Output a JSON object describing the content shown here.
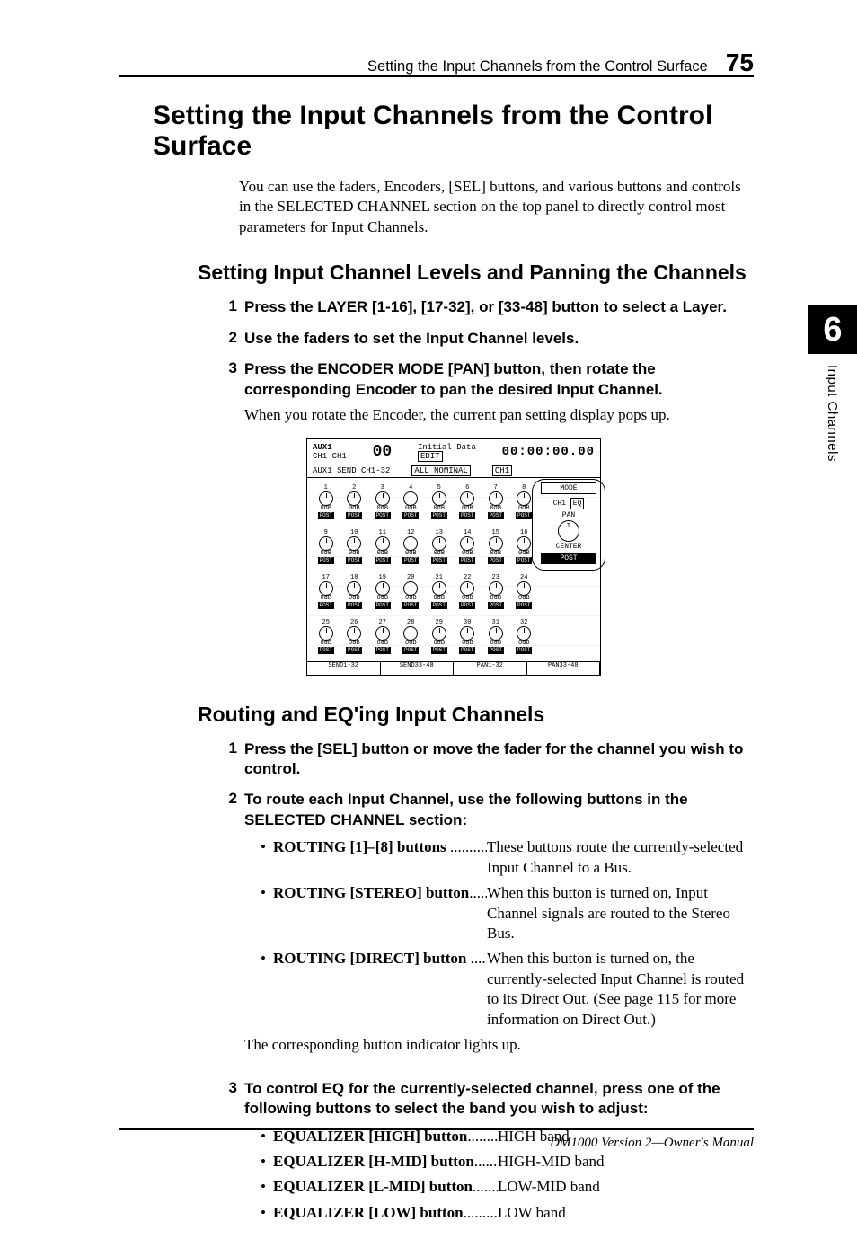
{
  "header": {
    "running_title": "Setting the Input Channels from the Control Surface",
    "page_num": "75"
  },
  "side_tab": {
    "chapter_num": "6",
    "chapter_label": "Input Channels"
  },
  "h1": "Setting the Input Channels from the Control Surface",
  "intro": "You can use the faders, Encoders, [SEL] buttons, and various buttons and controls in the SELECTED CHANNEL section on the top panel to directly control most parameters for Input Channels.",
  "sub1": {
    "title": "Setting Input Channel Levels and Panning the Channels",
    "steps": [
      {
        "n": "1",
        "head": "Press the LAYER [1-16], [17-32], or [33-48] button to select a Layer."
      },
      {
        "n": "2",
        "head": "Use the faders to set the Input Channel levels."
      },
      {
        "n": "3",
        "head": "Press the ENCODER MODE [PAN] button, then rotate the corresponding Encoder to pan the desired Input Channel.",
        "note": "When you rotate the Encoder, the current pan setting display pops up."
      }
    ]
  },
  "screenshot": {
    "title_left": "AUX1",
    "title_ch": "CH1-CH1",
    "scene": "00",
    "scene_label": "Initial Data",
    "edit": "EDIT",
    "time": "00:00:00.00",
    "sub_left": "AUX1  SEND  CH1-32",
    "sub_mid": "ALL NOMINAL",
    "sub_right": "CH1",
    "knob_db": "0dB",
    "knob_post": "POST",
    "right_mode": "MODE",
    "right_ch": "CH1",
    "right_eq": "EQ",
    "right_pan": "PAN",
    "right_center": "CENTER",
    "right_post": "POST",
    "tabs": [
      "SEND1-32",
      "SEND33-48",
      "PAN1-32",
      "PAN33-48"
    ]
  },
  "sub2": {
    "title": "Routing and EQ'ing Input Channels",
    "steps": [
      {
        "n": "1",
        "head": "Press the [SEL] button or move the fader for the channel you wish to control."
      },
      {
        "n": "2",
        "head": "To route each Input Channel, use the following buttons in the SELECTED CHANNEL section:",
        "routing": [
          {
            "label": "ROUTING [1]–[8] buttons",
            "dots": " ...............",
            "desc": "These buttons route the currently-selected Input Channel to a Bus."
          },
          {
            "label": "ROUTING [STEREO] button",
            "dots": "...........",
            "desc": "When this button is turned on, Input Channel signals are routed to the Stereo Bus."
          },
          {
            "label": "ROUTING [DIRECT] button",
            "dots": " ...........",
            "desc": "When this button is turned on, the currently-selected Input Channel is routed to its Direct Out. (See page 115 for more information on Direct Out.)"
          }
        ],
        "after": "The corresponding button indicator lights up."
      },
      {
        "n": "3",
        "head": "To control EQ for the currently-selected channel, press one of the following buttons to select the band you wish to adjust:",
        "eq": [
          {
            "label": "EQUALIZER [HIGH] button",
            "dots": "............",
            "desc": "HIGH band"
          },
          {
            "label": "EQUALIZER [H-MID] button",
            "dots": "..........",
            "desc": "HIGH-MID band"
          },
          {
            "label": "EQUALIZER [L-MID] button",
            "dots": "...........",
            "desc": "LOW-MID band"
          },
          {
            "label": "EQUALIZER [LOW] button",
            "dots": "..............",
            "desc": "LOW band"
          }
        ]
      }
    ]
  },
  "footer": "DM1000 Version 2—Owner's Manual"
}
